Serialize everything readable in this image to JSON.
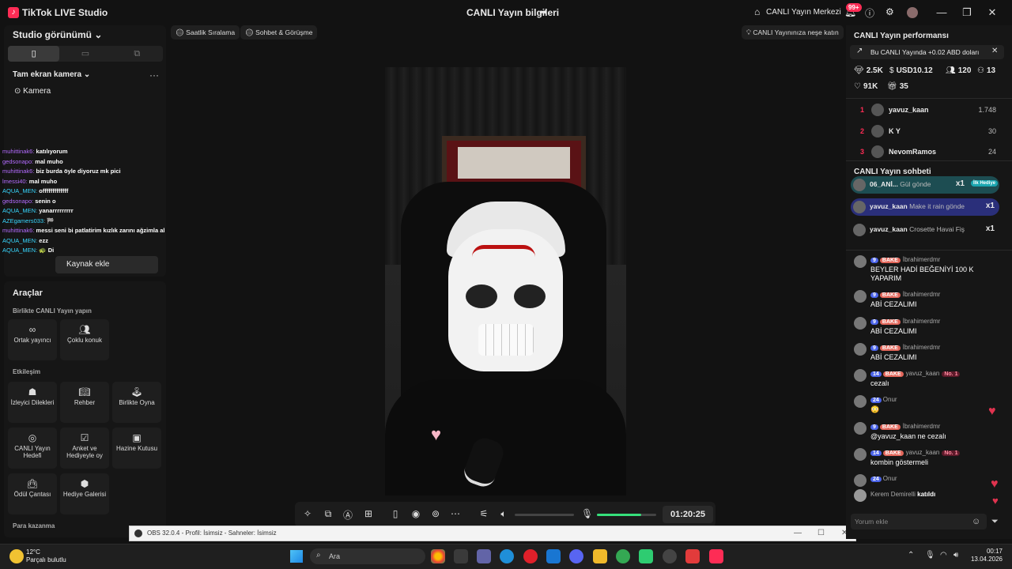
{
  "titlebar": {
    "app_name": "TikTok LIVE Studio",
    "center_title": "CANLI Yayın bilgileri",
    "live_center": "CANLI Yayın Merkezi",
    "notif_badge": "99+"
  },
  "left": {
    "studio_view": "Studio görünümü",
    "full_camera": "Tam ekran kamera",
    "camera": "Kamera",
    "add_source": "Kaynak ekle",
    "chat_log": [
      {
        "name": "muhittinak6:",
        "text": "katılıyorum",
        "cls": "n1"
      },
      {
        "name": "gedsonapo:",
        "text": "mal muho",
        "cls": "n1"
      },
      {
        "name": "muhittinak6:",
        "text": "biz burda öyle diyoruz mk pici",
        "cls": "n1"
      },
      {
        "name": "lmessi40:",
        "text": "mal muho",
        "cls": "n1"
      },
      {
        "name": "AQUA_MEN:",
        "text": "offfffffffffff",
        "cls": "n2"
      },
      {
        "name": "gedsonapo:",
        "text": "senin o",
        "cls": "n1"
      },
      {
        "name": "AQUA_MEN:",
        "text": "yanarrrrrrrrr",
        "cls": "n2"
      },
      {
        "name": "AZEgamers033:",
        "text": "🏁",
        "cls": "n2"
      },
      {
        "name": "muhittinak6:",
        "text": "messi seni bi patlatirim kızlık zarını ağzimla alırım",
        "cls": "n1"
      },
      {
        "name": "AQUA_MEN:",
        "text": "ezz",
        "cls": "n2"
      },
      {
        "name": "AQUA_MEN:",
        "text": "🐢 Di",
        "cls": "n2"
      }
    ],
    "tools_title": "Araçlar",
    "sections": {
      "together": "Birlikte CANLI Yayın yapın",
      "interaction": "Etkileşim",
      "earn": "Para kazanma"
    },
    "tools": {
      "cohost": "Ortak yayıncı",
      "multi_guest": "Çoklu konuk",
      "viewer_wishes": "İzleyici Dilekleri",
      "guide": "Rehber",
      "play_together": "Birlikte Oyna",
      "live_goal": "CANLI Yayın Hedefi",
      "poll": "Anket ve Hediyeyle oy",
      "treasure": "Hazine Kutusu",
      "reward_bag": "Ödül Çantası",
      "gift_gallery": "Hediye Galerisi"
    }
  },
  "top_pills": {
    "hourly": "Saatlik Sıralama",
    "chat_meet": "Sohbet & Görüşme",
    "fun": "CANLI Yayınınıza neşe katın"
  },
  "controls": {
    "timer": "01:20:25",
    "mic_level": 0.75
  },
  "obs": {
    "title": "OBS 32.0.4 - Profil: İsimsiz - Sahneler: İsimsiz"
  },
  "right": {
    "perf_title": "CANLI Yayın performansı",
    "perf_note": "Bu CANLI Yayında +0.02 ABD doları",
    "stats": {
      "diamonds": "2.5K",
      "usd": "USD10.12",
      "viewers": "120",
      "new_followers": "13",
      "likes": "91K",
      "gifters": "35"
    },
    "ranking": [
      {
        "rank": "1",
        "name": "yavuz_kaan",
        "score": "1.748"
      },
      {
        "rank": "2",
        "name": "K Y",
        "score": "30"
      },
      {
        "rank": "3",
        "name": "NevomRamos",
        "score": "24"
      }
    ],
    "chat_title": "CANLI Yayın sohbeti",
    "gifts": [
      {
        "name": "06_ANİ...",
        "text": "Gül gönde",
        "count": "x1",
        "badge": "İlk Hediye"
      },
      {
        "name": "yavuz_kaan",
        "text": "Make it rain gönde",
        "count": "x1"
      },
      {
        "name": "yavuz_kaan",
        "text": "Crosette Havai Fiş",
        "count": "x1"
      }
    ],
    "messages": [
      {
        "level": "9",
        "fan": "BAKE",
        "user": "İbrahimerdmr",
        "text": "BEYLER HADİ BEĞENİYİ 100 K YAPARIM"
      },
      {
        "level": "9",
        "fan": "BAKE",
        "user": "İbrahimerdmr",
        "text": "ABİ CEZALIMI"
      },
      {
        "level": "9",
        "fan": "BAKE",
        "user": "İbrahimerdmr",
        "text": "ABİ CEZALIMI"
      },
      {
        "level": "9",
        "fan": "BAKE",
        "user": "İbrahimerdmr",
        "text": "ABİ CEZALIMI"
      },
      {
        "level": "14",
        "fan": "BAKE",
        "user": "yavuz_kaan",
        "no1": "No. 1",
        "text": "cezalı"
      },
      {
        "level": "24",
        "user": "Onur",
        "text": "😳"
      },
      {
        "level": "9",
        "fan": "BAKE",
        "user": "İbrahimerdmr",
        "text": "@yavuz_kaan ne cezalı"
      },
      {
        "level": "14",
        "fan": "BAKE",
        "user": "yavuz_kaan",
        "no1": "No. 1",
        "text": "kombin göstermeli"
      },
      {
        "level": "24",
        "user": "Onur",
        "text": ""
      }
    ],
    "joined": {
      "user": "Kerem Demirelli",
      "text": "katıldı"
    },
    "comment_placeholder": "Yorum ekle"
  },
  "taskbar": {
    "temp": "12°C",
    "weather": "Parçalı bulutlu",
    "search": "Ara",
    "time": "00:17",
    "date": "13.04.2026"
  },
  "colors": {
    "accent": "#fe2c55",
    "mic_level": "#36e07b",
    "level_badge": "#4a63e8"
  }
}
